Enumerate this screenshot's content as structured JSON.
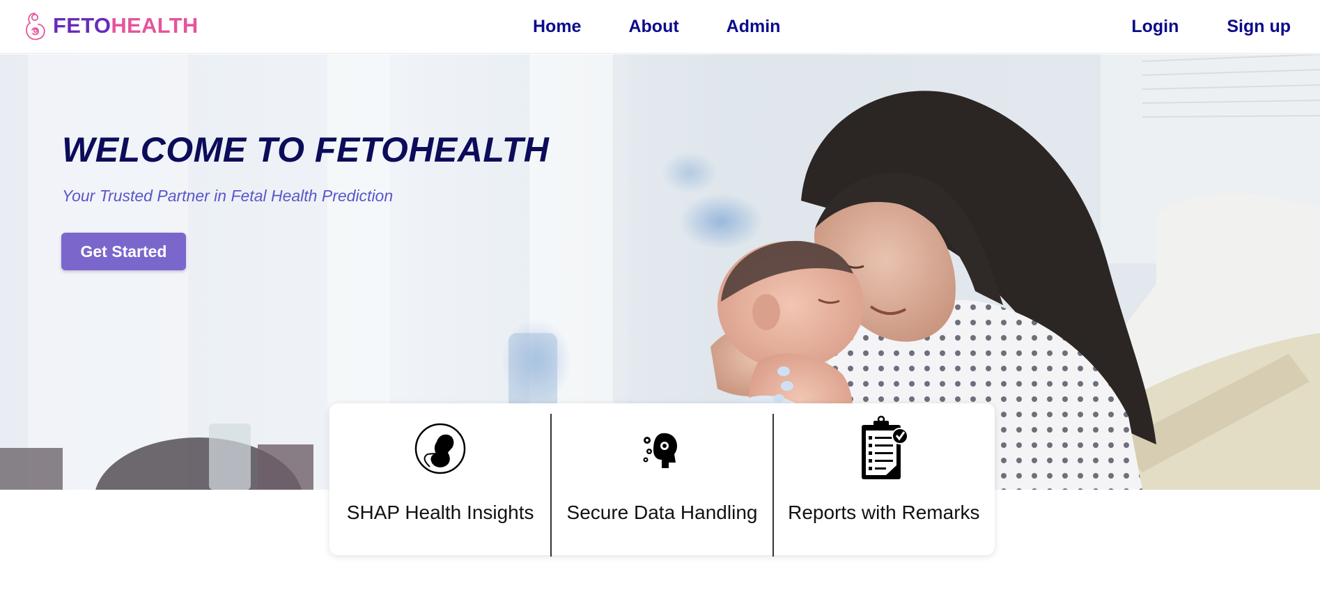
{
  "brand": {
    "name_part1": "FETO",
    "name_part2": "HEALTH",
    "logo_icon": "mother-baby-icon"
  },
  "nav": {
    "center": [
      {
        "label": "Home"
      },
      {
        "label": "About"
      },
      {
        "label": "Admin"
      }
    ],
    "right": [
      {
        "label": "Login"
      },
      {
        "label": "Sign up"
      }
    ]
  },
  "hero": {
    "title": "WELCOME TO FETOHEALTH",
    "subtitle": "Your Trusted Partner in Fetal Health Prediction",
    "cta_label": "Get Started",
    "image": "mother-newborn-photo"
  },
  "features": [
    {
      "label": "SHAP Health Insights",
      "icon": "fetus-icon"
    },
    {
      "label": "Secure Data Handling",
      "icon": "brain-gears-icon"
    },
    {
      "label": "Reports with Remarks",
      "icon": "clipboard-checklist-icon"
    }
  ],
  "colors": {
    "brand_purple": "#6a2bb8",
    "brand_pink": "#e5559a",
    "nav_text": "#0b0b8c",
    "hero_title": "#0c0c5a",
    "hero_subtitle": "#5a55c8",
    "cta_bg": "#7b66cc"
  }
}
